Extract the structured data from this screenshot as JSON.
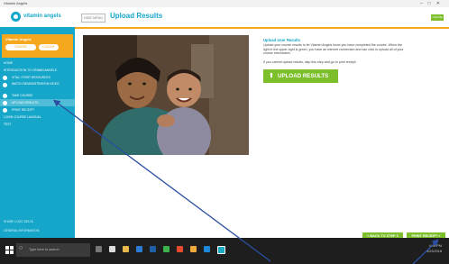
{
  "window": {
    "title": "Vitamin Angels"
  },
  "brand": {
    "logo_text": "vitamin angels",
    "primary_color": "#16a6c9",
    "accent_color": "#f5a81d",
    "success_color": "#7cbf2a"
  },
  "sidebar": {
    "module_title": "Vitamin Angels",
    "pill_a": "COURSE RESOURCES",
    "pill_b": "LOGOUT",
    "items": [
      {
        "label": "HOME",
        "step": false
      },
      {
        "label": "INTRODUCTION TO VITAMIN ANGELS",
        "step": false
      },
      {
        "label": "VITAL / FIRST RESOURCES",
        "step": true
      },
      {
        "label": "WATCH DEMONSTRATION VIDEO",
        "step": true
      },
      {
        "label": "TAKE COURSE",
        "step": true
      },
      {
        "label": "UPLOAD RESULTS",
        "step": true,
        "active": true
      },
      {
        "label": "PRINT RECEIPT",
        "step": true
      },
      {
        "label": "LOGIN COURSE LANGUAL",
        "step": false
      },
      {
        "label": "TEST",
        "step": false
      }
    ],
    "footer_1": "SHARE LOGO DELTA",
    "footer_2": "GENERAL INFORMATION"
  },
  "header": {
    "hide_menu": "HIDE MENU",
    "title": "Upload Results",
    "online": "ONLINE"
  },
  "main": {
    "section_title": "Upload User Results",
    "paragraph_1": "Upload your course results to let Vitamin Angels know you have completed the course. When the light in the upper-right is green, you have an internet connection and can click to upload all of your course information.",
    "paragraph_2": "If you cannot upload results, skip this step and go to print receipt.",
    "upload_button": "UPLOAD RESULTS (127)",
    "upload_icon": "upload-icon",
    "back_button": "« BACK TO STEP 3",
    "next_button": "PRINT RECEIPT »"
  },
  "taskbar": {
    "search_placeholder": "Type here to search",
    "time": "4:06 PM",
    "date": "3/23/2018"
  }
}
